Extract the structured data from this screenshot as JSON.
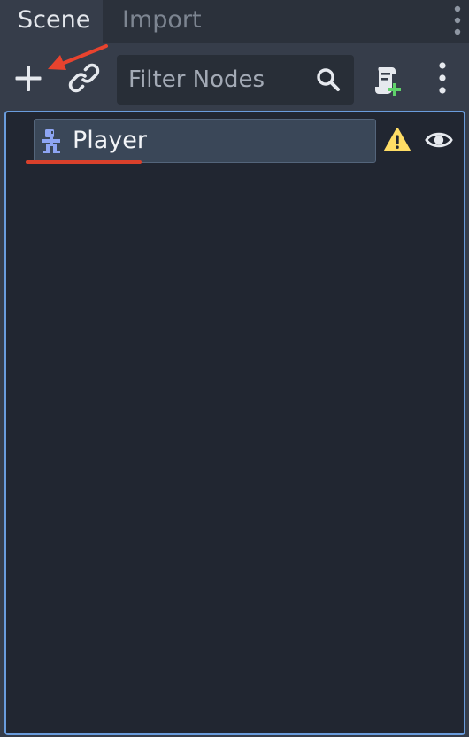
{
  "tabs": [
    {
      "label": "Scene",
      "active": true
    },
    {
      "label": "Import",
      "active": false
    }
  ],
  "toolbar": {
    "filter": {
      "placeholder": "Filter Nodes",
      "value": ""
    },
    "icons": {
      "add": "plus-icon",
      "instance": "link-icon",
      "search": "search-icon",
      "script": "attach-script-icon",
      "more": "vertical-ellipsis-icon"
    }
  },
  "tree": {
    "nodes": [
      {
        "label": "Player",
        "type_icon": "character-body-icon",
        "warning_icon": "warning-icon",
        "visibility_icon": "eye-icon"
      }
    ]
  },
  "annotations": {
    "arrow_color": "#e8432e",
    "underline_color": "#d9402b"
  },
  "colors": {
    "panel_background": "#363d4a",
    "tree_background": "#212631",
    "focus_border": "#6a9cdc",
    "selected_row": "#3a4758",
    "node_icon": "#8da5f3",
    "warning": "#ffdd65"
  }
}
